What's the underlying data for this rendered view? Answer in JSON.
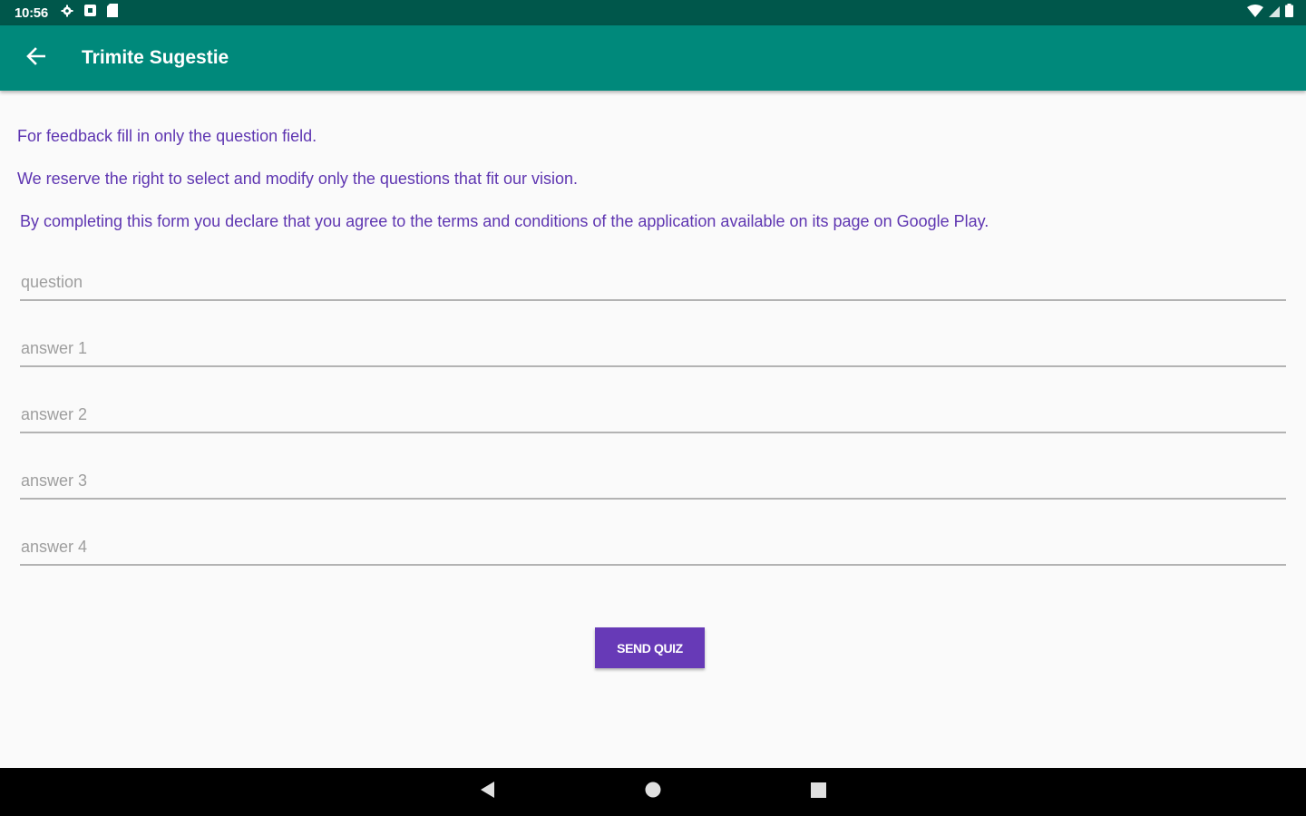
{
  "status_bar": {
    "time": "10:56",
    "icons": [
      "settings-gear-icon",
      "notification-square-icon",
      "sd-card-icon"
    ],
    "right_icons": [
      "wifi-icon",
      "signal-icon",
      "battery-icon"
    ]
  },
  "app_bar": {
    "title": "Trimite Sugestie",
    "back_icon": "arrow-back-icon",
    "color": "#00897b",
    "status_color": "#00574b"
  },
  "info": {
    "line1": "For feedback fill in only the question field.",
    "line2": "We reserve the right to select and modify only the questions that fit our vision.",
    "line3": "By completing this form you declare that you agree to the terms and conditions of the application available on its page on Google Play.",
    "color": "#5e35b1"
  },
  "form": {
    "question_placeholder": "question",
    "answer1_placeholder": "answer 1",
    "answer2_placeholder": "answer 2",
    "answer3_placeholder": "answer 3",
    "answer4_placeholder": "answer 4",
    "question_value": "",
    "answer1_value": "",
    "answer2_value": "",
    "answer3_value": "",
    "answer4_value": ""
  },
  "actions": {
    "send_label": "SEND QUIZ",
    "button_color": "#673ab7"
  },
  "nav_bar": {
    "buttons": [
      "back-triangle-icon",
      "home-circle-icon",
      "recents-square-icon"
    ]
  }
}
